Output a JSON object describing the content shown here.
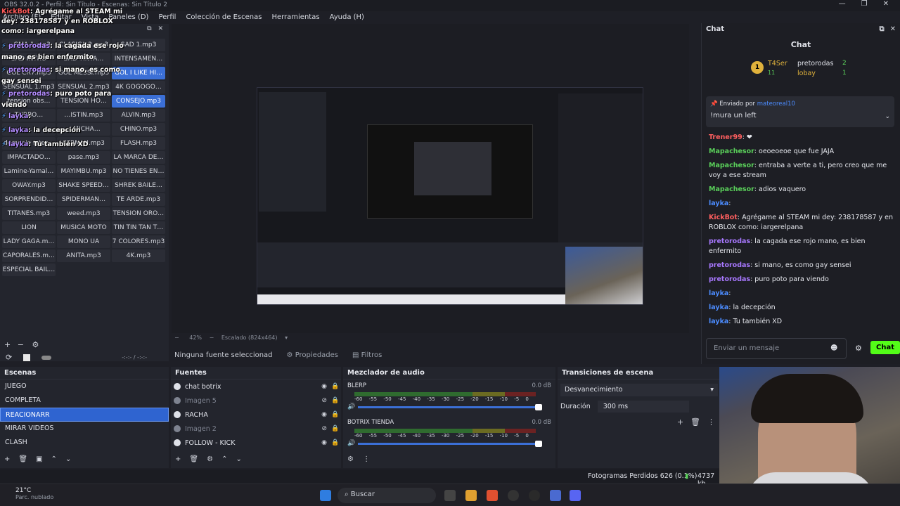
{
  "window": {
    "title": "OBS 32.0.2 - Perfil: Sin Título - Escenas: Sin Título 2",
    "controls": [
      "—",
      "❐",
      "✕"
    ]
  },
  "menu": [
    "Archivo (F)",
    "Editar",
    "Vista",
    "Paneles (D)",
    "Perfil",
    "Colección de Escenas",
    "Herramientas",
    "Ayuda (H)"
  ],
  "soundboard": {
    "buttons": [
      "…GMA 1.mp3",
      "CLASICA 2.mp3",
      "SAD 1.mp3",
      "SAD INTRO",
      "SAD TINTA…",
      "INTENSAMEN…",
      "GOL CR7.mp3",
      "GOL MESSI.mp3",
      "GOL I LIKE HI…",
      "SENSUAL 1.mp3",
      "SENSUAL 2.mp3",
      "4K GOGOGO…",
      "tension obs…",
      "TENSION HO…",
      "CONSEJO.mp3",
      "TURBO…",
      "…ISTIN.mp3",
      "ALVIN.mp3",
      "…",
      "…MICHA…",
      "CHINO.mp3",
      "demonio inter…",
      "FERNAN.mp3",
      "FLASH.mp3",
      "IMPACTADO…",
      "pase.mp3",
      "LA MARCA DE…",
      "Lamine-Yamal…",
      "MAYIMBU.mp3",
      "NO TIENES EN…",
      "OWAY.mp3",
      "SHAKE SPEED…",
      "SHREK BAILE…",
      "SORPRENDID…",
      "SPIDERMAN…",
      "TE ARDE.mp3",
      "TITANES.mp3",
      "weed.mp3",
      "TENSION ORO…",
      "LION",
      "MUSICA MOTO",
      "TIN TIN TAN T…",
      "LADY GAGA.m…",
      "MONO UA",
      "7 COLORES.mp3",
      "CAPORALES.m…",
      "ANITA.mp3",
      "4K.mp3",
      "ESPECIAL BAIL…"
    ],
    "active": [
      8,
      14
    ]
  },
  "overlay_chat": [
    {
      "user": "KickBot",
      "text": ": Agrégame al STEAM mi dey: 238178587 y en ROBLOX como: iargerelpana"
    },
    {
      "user": "pretorodas",
      "text": ": la cagada ese rojo mano, es bien enfermito"
    },
    {
      "user": "pretorodas",
      "text": ": si mano, es como gay sensei"
    },
    {
      "user": "pretorodas",
      "text": ": puro poto para viendo"
    },
    {
      "user": "layka",
      "text": ":"
    },
    {
      "user": "layka",
      "text": ": la decepción"
    },
    {
      "user": "layka",
      "text": ": Tu también XD"
    }
  ],
  "preview": {
    "zoom": "42%",
    "scaled": "Escalado (824x464)"
  },
  "source_bar": {
    "none_selected": "Ninguna fuente seleccionad",
    "properties": "Propiedades",
    "filters": "Filtros"
  },
  "chat": {
    "title": "Chat",
    "header": "Chat",
    "leaderboard": [
      {
        "rank": "1",
        "name": "T4Ser",
        "count": "11"
      },
      {
        "rank": "",
        "name": "pretorodas",
        "count": "2"
      },
      {
        "rank": "",
        "name": "lobay",
        "count": "1"
      }
    ],
    "pinned_by_label": "Enviado por",
    "pinned_by": "mateoreal10",
    "pinned_text": "!mura un left",
    "messages": [
      {
        "user": "Trener99",
        "text": ": ❤",
        "color": "r"
      },
      {
        "user": "Mapachesor",
        "text": ": oeoeoeoe que fue JAJA",
        "color": "g"
      },
      {
        "user": "Mapachesor",
        "text": ": entraba a verte a ti, pero creo que me voy a ese stream",
        "color": "g"
      },
      {
        "user": "Mapachesor",
        "text": ": adios vaquero",
        "color": "g"
      },
      {
        "user": "layka",
        "text": ":",
        "color": ""
      },
      {
        "user": "KickBot",
        "text": ": Agrégame al STEAM mi dey: 238178587 y en ROBLOX como: iargerelpana",
        "color": "r"
      },
      {
        "user": "pretorodas",
        "text": ": la cagada ese rojo mano, es bien enfermito",
        "color": "p"
      },
      {
        "user": "pretorodas",
        "text": ": si mano, es como gay sensei",
        "color": "p"
      },
      {
        "user": "pretorodas",
        "text": ": puro poto para viendo",
        "color": "p"
      },
      {
        "user": "layka",
        "text": ":",
        "color": ""
      },
      {
        "user": "layka",
        "text": ": la decepción",
        "color": ""
      },
      {
        "user": "layka",
        "text": ": Tu también XD",
        "color": ""
      }
    ],
    "input_placeholder": "Enviar un mensaje",
    "send_label": "Chat"
  },
  "scenes": {
    "title": "Escenas",
    "items": [
      "JUEGO",
      "COMPLETA",
      "REACIONARR",
      "MIRAR VIDEOS",
      "CLASH"
    ],
    "selected": 2
  },
  "sources": {
    "title": "Fuentes",
    "items": [
      {
        "name": "chat botrix",
        "dim": false
      },
      {
        "name": "Imagen 5",
        "dim": true
      },
      {
        "name": "RACHA",
        "dim": false
      },
      {
        "name": "Imagen 2",
        "dim": true
      },
      {
        "name": "FOLLOW - KICK",
        "dim": false
      }
    ]
  },
  "mixer": {
    "title": "Mezclador de audio",
    "channels": [
      {
        "name": "BLERP",
        "db": "0.0 dB"
      },
      {
        "name": "BOTRIX TIENDA",
        "db": "0.0 dB"
      }
    ],
    "scale": [
      "-60",
      "-55",
      "-50",
      "-45",
      "-40",
      "-35",
      "-30",
      "-25",
      "-20",
      "-15",
      "-10",
      "-5",
      "0"
    ]
  },
  "transitions": {
    "title": "Transiciones de escena",
    "selected": "Desvanecimiento",
    "duration_label": "Duración",
    "duration": "300 ms"
  },
  "status": {
    "dropped": "Fotogramas Perdidos 626 (0.1%)",
    "bitrate": "4737 kb"
  },
  "taskbar": {
    "temp": "21°C",
    "weather": "Parc. nublado",
    "search": "Buscar"
  },
  "colors": {
    "accent": "#2f64d0",
    "kick_green": "#53fc18"
  }
}
